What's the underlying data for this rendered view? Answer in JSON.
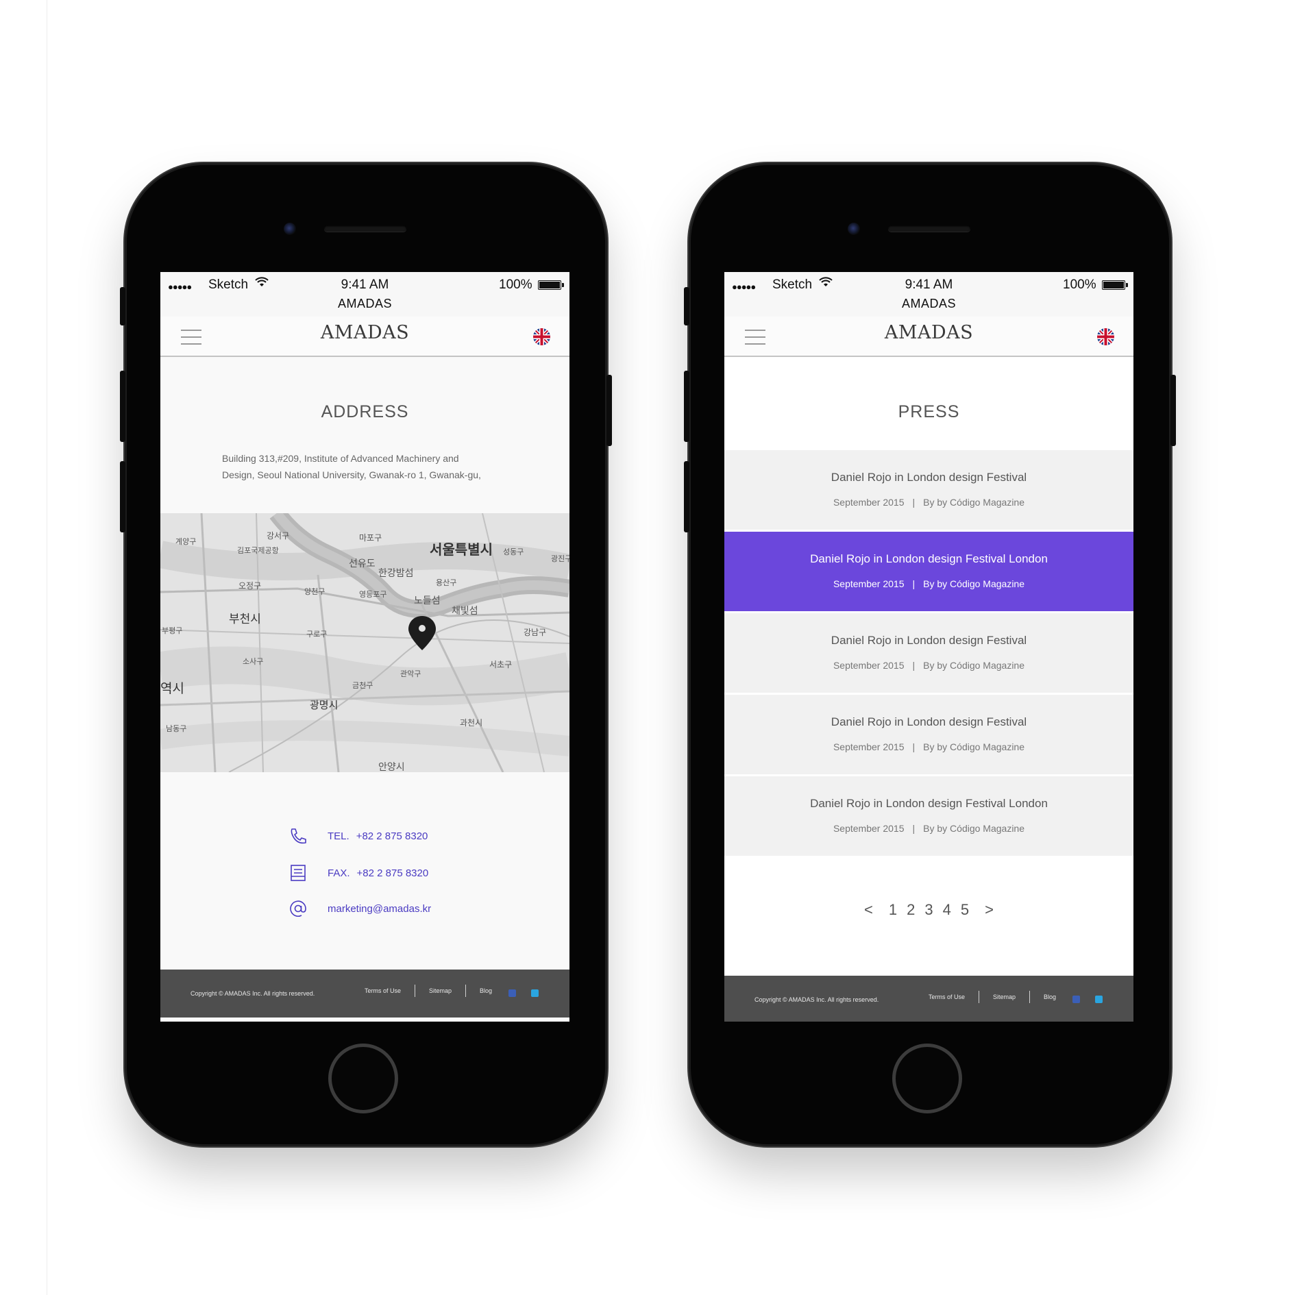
{
  "status_bar": {
    "carrier": "Sketch",
    "time": "9:41 AM",
    "battery": "100%",
    "app_name": "AMADAS"
  },
  "brand": {
    "logo_text": "AMADAS",
    "accent_color": "#6b47dc"
  },
  "address_page": {
    "title": "ADDRESS",
    "address_line1": "Building 313,#209, Institute of Advanced Machinery and",
    "address_line2": "Design, Seoul National University, Gwanak-ro 1, Gwanak-gu,",
    "map_labels": [
      "강서구",
      "김포국제공항",
      "계양구",
      "마포구",
      "서울특별시",
      "성동구",
      "광진구",
      "선유도",
      "한강밤섬",
      "용산구",
      "오정구",
      "양천구",
      "영등포구",
      "노들섬",
      "채빛섬",
      "부천시",
      "부평구",
      "구로구",
      "강남구",
      "소사구",
      "서초구",
      "관악구",
      "역시",
      "금천구",
      "광명시",
      "남동구",
      "과천시",
      "안양시"
    ],
    "contacts": [
      {
        "icon": "phone-icon",
        "label": "TEL.",
        "value": "+82 2 875 8320"
      },
      {
        "icon": "fax-icon",
        "label": "FAX.",
        "value": "+82 2 875 8320"
      },
      {
        "icon": "at-icon",
        "label": "",
        "value": "marketing@amadas.kr"
      }
    ]
  },
  "press_page": {
    "title": "PRESS",
    "items": [
      {
        "title": "Daniel Rojo in London design Festival",
        "date": "September 2015",
        "source": "By by Código Magazine",
        "active": false
      },
      {
        "title": "Daniel Rojo in London design Festival London",
        "date": "September 2015",
        "source": "By by Código Magazine",
        "active": true
      },
      {
        "title": "Daniel Rojo in London design Festival",
        "date": "September 2015",
        "source": "By by Código Magazine",
        "active": false
      },
      {
        "title": "Daniel Rojo in London design Festival",
        "date": "September 2015",
        "source": "By by Código Magazine",
        "active": false
      },
      {
        "title": "Daniel Rojo in London design Festival London",
        "date": "September 2015",
        "source": "By by Código Magazine",
        "active": false
      }
    ],
    "separator": "|",
    "pagination": {
      "prev": "<",
      "pages": [
        "1",
        "2",
        "3",
        "4",
        "5"
      ],
      "next": ">"
    }
  },
  "footer": {
    "copyright": "Copyright © AMADAS Inc. All rights reserved.",
    "links": [
      "Terms of Use",
      "Sitemap",
      "Blog"
    ],
    "social": [
      "facebook-icon",
      "twitter-icon"
    ]
  }
}
